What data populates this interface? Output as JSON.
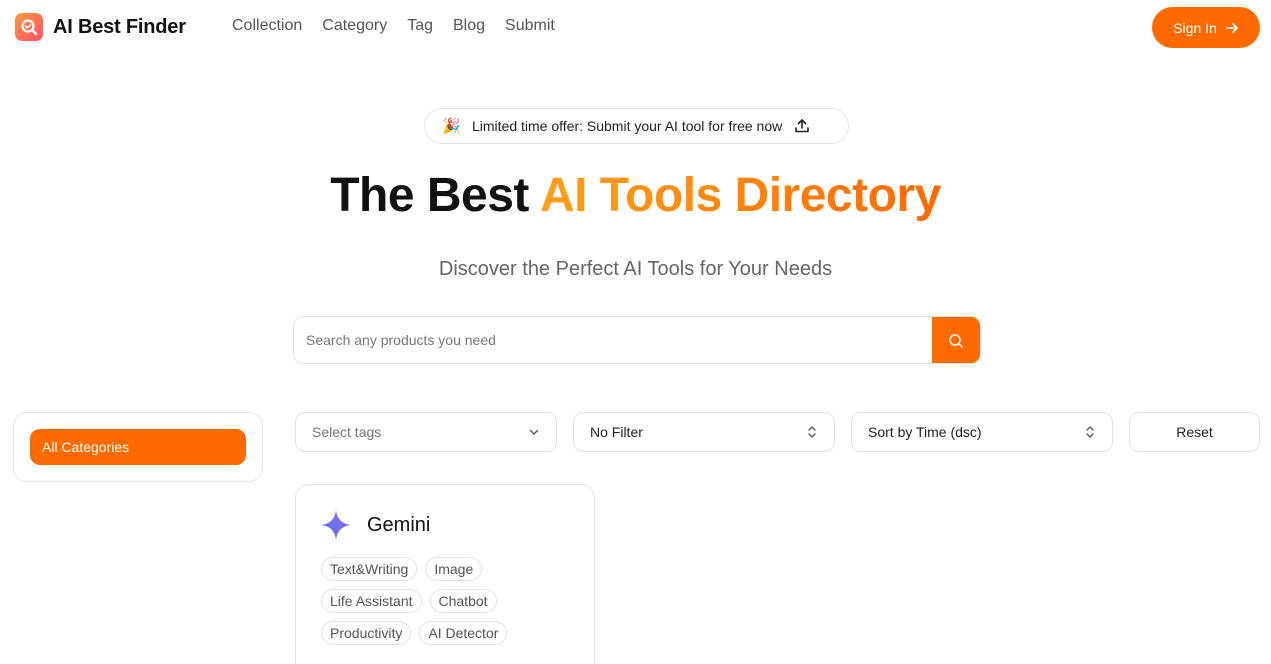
{
  "header": {
    "brand": "AI Best Finder",
    "nav": [
      "Collection",
      "Category",
      "Tag",
      "Blog",
      "Submit"
    ],
    "signin_label": "Sign In"
  },
  "hero": {
    "offer_text": "Limited time offer: Submit your AI tool for free now",
    "offer_emoji": "🎉",
    "title_plain": "The Best ",
    "title_highlight": "AI Tools Directory",
    "subtitle": "Discover the Perfect AI Tools for Your Needs",
    "search_placeholder": "Search any products you need"
  },
  "sidebar": {
    "active_category": "All Categories"
  },
  "filters": {
    "tags_placeholder": "Select tags",
    "filter_value": "No Filter",
    "sort_value": "Sort by Time (dsc)",
    "reset_label": "Reset"
  },
  "cards": [
    {
      "name": "Gemini",
      "icon": "gemini-sparkle-icon",
      "tags": [
        [
          "Text&Writing",
          "Image"
        ],
        [
          "Life Assistant",
          "Chatbot"
        ],
        [
          "Productivity",
          "AI Detector"
        ]
      ]
    }
  ],
  "colors": {
    "accent": "#ff6a00",
    "accent_light": "#ff9f1a",
    "border": "#e2e2e2",
    "muted_text": "#555555"
  }
}
